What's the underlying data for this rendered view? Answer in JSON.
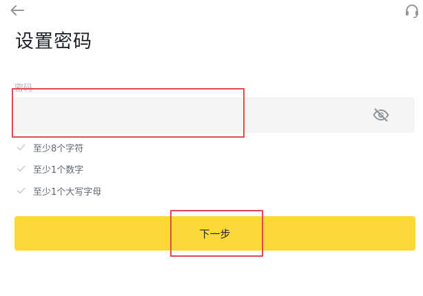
{
  "header": {
    "back_icon": "arrow-left-icon",
    "support_icon": "headset-icon"
  },
  "page": {
    "title": "设置密码"
  },
  "password_field": {
    "label": "密码",
    "value": "",
    "placeholder": "",
    "visibility_icon": "eye-off-icon"
  },
  "requirements": [
    {
      "label": "至少8个字符",
      "icon": "check-icon"
    },
    {
      "label": "至少1个数字",
      "icon": "check-icon"
    },
    {
      "label": "至少1个大写字母",
      "icon": "check-icon"
    }
  ],
  "actions": {
    "next_label": "下一步"
  },
  "colors": {
    "primary_button": "#fcd838",
    "input_background": "#f5f5f5",
    "highlight_outline": "#e5484d",
    "text_primary": "#1e2329",
    "text_secondary": "#5e6673",
    "text_muted": "#aeb4bc"
  }
}
